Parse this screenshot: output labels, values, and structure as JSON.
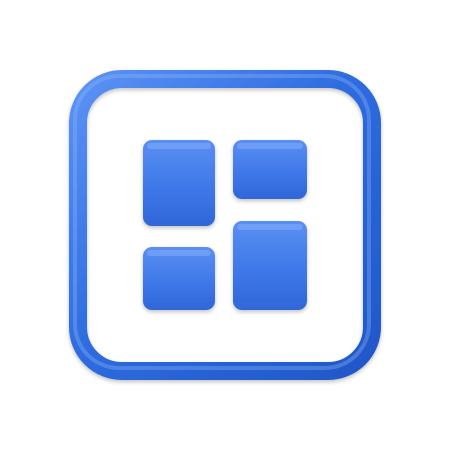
{
  "icon": {
    "name": "dashboard-grid-icon",
    "colors": {
      "frame": "#2f6de0",
      "frame_highlight": "#5b92f5",
      "tile": "#3f78e8",
      "tile_highlight": "#6d9cf5",
      "background": "#ffffff"
    }
  }
}
